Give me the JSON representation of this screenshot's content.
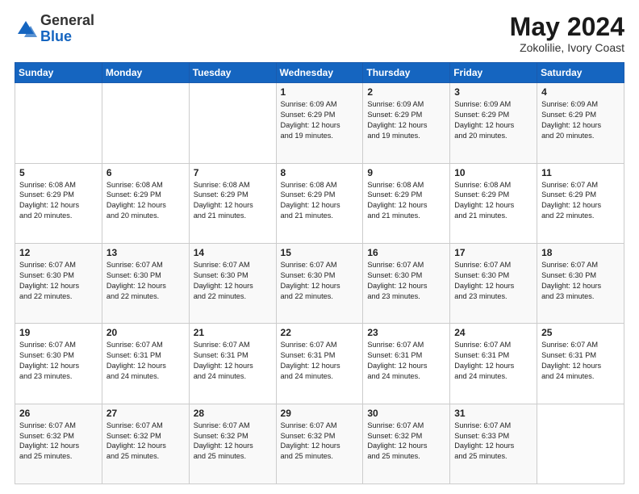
{
  "header": {
    "logo_general": "General",
    "logo_blue": "Blue",
    "month_year": "May 2024",
    "location": "Zokolilie, Ivory Coast"
  },
  "days_of_week": [
    "Sunday",
    "Monday",
    "Tuesday",
    "Wednesday",
    "Thursday",
    "Friday",
    "Saturday"
  ],
  "weeks": [
    [
      {
        "day": "",
        "info": ""
      },
      {
        "day": "",
        "info": ""
      },
      {
        "day": "",
        "info": ""
      },
      {
        "day": "1",
        "info": "Sunrise: 6:09 AM\nSunset: 6:29 PM\nDaylight: 12 hours\nand 19 minutes."
      },
      {
        "day": "2",
        "info": "Sunrise: 6:09 AM\nSunset: 6:29 PM\nDaylight: 12 hours\nand 19 minutes."
      },
      {
        "day": "3",
        "info": "Sunrise: 6:09 AM\nSunset: 6:29 PM\nDaylight: 12 hours\nand 20 minutes."
      },
      {
        "day": "4",
        "info": "Sunrise: 6:09 AM\nSunset: 6:29 PM\nDaylight: 12 hours\nand 20 minutes."
      }
    ],
    [
      {
        "day": "5",
        "info": "Sunrise: 6:08 AM\nSunset: 6:29 PM\nDaylight: 12 hours\nand 20 minutes."
      },
      {
        "day": "6",
        "info": "Sunrise: 6:08 AM\nSunset: 6:29 PM\nDaylight: 12 hours\nand 20 minutes."
      },
      {
        "day": "7",
        "info": "Sunrise: 6:08 AM\nSunset: 6:29 PM\nDaylight: 12 hours\nand 21 minutes."
      },
      {
        "day": "8",
        "info": "Sunrise: 6:08 AM\nSunset: 6:29 PM\nDaylight: 12 hours\nand 21 minutes."
      },
      {
        "day": "9",
        "info": "Sunrise: 6:08 AM\nSunset: 6:29 PM\nDaylight: 12 hours\nand 21 minutes."
      },
      {
        "day": "10",
        "info": "Sunrise: 6:08 AM\nSunset: 6:29 PM\nDaylight: 12 hours\nand 21 minutes."
      },
      {
        "day": "11",
        "info": "Sunrise: 6:07 AM\nSunset: 6:29 PM\nDaylight: 12 hours\nand 22 minutes."
      }
    ],
    [
      {
        "day": "12",
        "info": "Sunrise: 6:07 AM\nSunset: 6:30 PM\nDaylight: 12 hours\nand 22 minutes."
      },
      {
        "day": "13",
        "info": "Sunrise: 6:07 AM\nSunset: 6:30 PM\nDaylight: 12 hours\nand 22 minutes."
      },
      {
        "day": "14",
        "info": "Sunrise: 6:07 AM\nSunset: 6:30 PM\nDaylight: 12 hours\nand 22 minutes."
      },
      {
        "day": "15",
        "info": "Sunrise: 6:07 AM\nSunset: 6:30 PM\nDaylight: 12 hours\nand 22 minutes."
      },
      {
        "day": "16",
        "info": "Sunrise: 6:07 AM\nSunset: 6:30 PM\nDaylight: 12 hours\nand 23 minutes."
      },
      {
        "day": "17",
        "info": "Sunrise: 6:07 AM\nSunset: 6:30 PM\nDaylight: 12 hours\nand 23 minutes."
      },
      {
        "day": "18",
        "info": "Sunrise: 6:07 AM\nSunset: 6:30 PM\nDaylight: 12 hours\nand 23 minutes."
      }
    ],
    [
      {
        "day": "19",
        "info": "Sunrise: 6:07 AM\nSunset: 6:30 PM\nDaylight: 12 hours\nand 23 minutes."
      },
      {
        "day": "20",
        "info": "Sunrise: 6:07 AM\nSunset: 6:31 PM\nDaylight: 12 hours\nand 24 minutes."
      },
      {
        "day": "21",
        "info": "Sunrise: 6:07 AM\nSunset: 6:31 PM\nDaylight: 12 hours\nand 24 minutes."
      },
      {
        "day": "22",
        "info": "Sunrise: 6:07 AM\nSunset: 6:31 PM\nDaylight: 12 hours\nand 24 minutes."
      },
      {
        "day": "23",
        "info": "Sunrise: 6:07 AM\nSunset: 6:31 PM\nDaylight: 12 hours\nand 24 minutes."
      },
      {
        "day": "24",
        "info": "Sunrise: 6:07 AM\nSunset: 6:31 PM\nDaylight: 12 hours\nand 24 minutes."
      },
      {
        "day": "25",
        "info": "Sunrise: 6:07 AM\nSunset: 6:31 PM\nDaylight: 12 hours\nand 24 minutes."
      }
    ],
    [
      {
        "day": "26",
        "info": "Sunrise: 6:07 AM\nSunset: 6:32 PM\nDaylight: 12 hours\nand 25 minutes."
      },
      {
        "day": "27",
        "info": "Sunrise: 6:07 AM\nSunset: 6:32 PM\nDaylight: 12 hours\nand 25 minutes."
      },
      {
        "day": "28",
        "info": "Sunrise: 6:07 AM\nSunset: 6:32 PM\nDaylight: 12 hours\nand 25 minutes."
      },
      {
        "day": "29",
        "info": "Sunrise: 6:07 AM\nSunset: 6:32 PM\nDaylight: 12 hours\nand 25 minutes."
      },
      {
        "day": "30",
        "info": "Sunrise: 6:07 AM\nSunset: 6:32 PM\nDaylight: 12 hours\nand 25 minutes."
      },
      {
        "day": "31",
        "info": "Sunrise: 6:07 AM\nSunset: 6:33 PM\nDaylight: 12 hours\nand 25 minutes."
      },
      {
        "day": "",
        "info": ""
      }
    ]
  ]
}
